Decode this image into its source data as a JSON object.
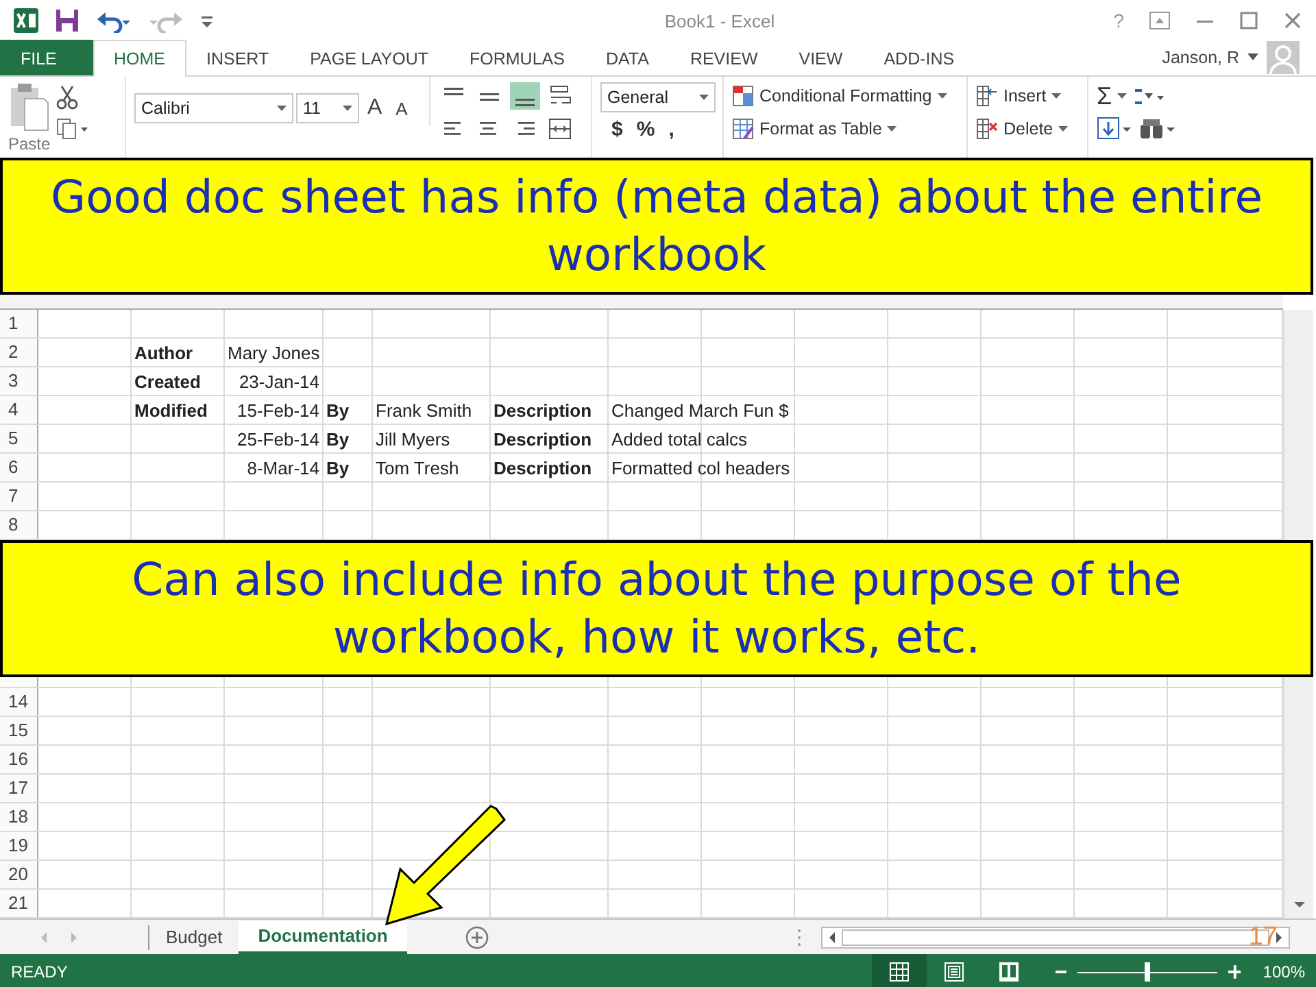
{
  "window": {
    "title": "Book1 - Excel",
    "help": "?"
  },
  "quick_access": {
    "redo": {
      "disabled": true
    }
  },
  "tabs": [
    {
      "label": "FILE",
      "kind": "file",
      "selected": false
    },
    {
      "label": "HOME",
      "kind": "tab",
      "selected": true
    },
    {
      "label": "INSERT",
      "kind": "tab",
      "selected": false
    },
    {
      "label": "PAGE LAYOUT",
      "kind": "tab",
      "selected": false
    },
    {
      "label": "FORMULAS",
      "kind": "tab",
      "selected": false
    },
    {
      "label": "DATA",
      "kind": "tab",
      "selected": false
    },
    {
      "label": "REVIEW",
      "kind": "tab",
      "selected": false
    },
    {
      "label": "VIEW",
      "kind": "tab",
      "selected": false
    },
    {
      "label": "ADD-INS",
      "kind": "tab",
      "selected": false
    }
  ],
  "account": {
    "name": "Janson, R"
  },
  "ribbon": {
    "paste_label": "Paste",
    "font_name": "Calibri",
    "font_size": "11",
    "font_buttons": [
      "A",
      "A"
    ],
    "alignment": [
      {
        "kind": "top",
        "selected": false
      },
      {
        "kind": "middle",
        "selected": false
      },
      {
        "kind": "bottom",
        "selected": true
      },
      {
        "kind": "wrap",
        "selected": false
      },
      {
        "kind": "left",
        "selected": false
      },
      {
        "kind": "center",
        "selected": false
      },
      {
        "kind": "right",
        "selected": false
      },
      {
        "kind": "merge",
        "selected": false
      }
    ],
    "number_format": "General",
    "number_buttons": [
      "$",
      "%",
      ","
    ],
    "styles": [
      {
        "kind": "conditional",
        "label": "Conditional Formatting"
      },
      {
        "kind": "table",
        "label": "Format as Table"
      }
    ],
    "cells": [
      {
        "kind": "insert",
        "label": "Insert"
      },
      {
        "kind": "delete",
        "label": "Delete"
      }
    ],
    "editing_symbol": "Σ"
  },
  "sheet": {
    "rows_top": [
      {
        "number": "1"
      },
      {
        "number": "2",
        "cells": [
          null,
          {
            "kind": "label",
            "text": "Author"
          },
          {
            "kind": "text",
            "text": "Mary Jones"
          }
        ]
      },
      {
        "number": "3",
        "cells": [
          null,
          {
            "kind": "label",
            "text": "Created"
          },
          {
            "kind": "date",
            "text": "23-Jan-14"
          }
        ]
      },
      {
        "number": "4",
        "cells": [
          null,
          {
            "kind": "label",
            "text": "Modified"
          },
          {
            "kind": "date",
            "text": "15-Feb-14"
          },
          {
            "kind": "label",
            "text": "By"
          },
          {
            "kind": "text",
            "text": "Frank Smith"
          },
          {
            "kind": "label",
            "text": "Description"
          },
          {
            "kind": "text",
            "text": "Changed March Fun $"
          }
        ]
      },
      {
        "number": "5",
        "cells": [
          null,
          null,
          {
            "kind": "date",
            "text": "25-Feb-14"
          },
          {
            "kind": "label",
            "text": "By"
          },
          {
            "kind": "text",
            "text": "Jill Myers"
          },
          {
            "kind": "label",
            "text": "Description"
          },
          {
            "kind": "text",
            "text": "Added total calcs"
          }
        ]
      },
      {
        "number": "6",
        "cells": [
          null,
          null,
          {
            "kind": "date",
            "text": "8-Mar-14"
          },
          {
            "kind": "label",
            "text": "By"
          },
          {
            "kind": "text",
            "text": "Tom Tresh"
          },
          {
            "kind": "label",
            "text": "Description"
          },
          {
            "kind": "text",
            "text": "Formatted col headers"
          }
        ]
      },
      {
        "number": "7"
      },
      {
        "number": "8"
      }
    ],
    "rows_bottom": [
      {
        "number": "14"
      },
      {
        "number": "15"
      },
      {
        "number": "16"
      },
      {
        "number": "17"
      },
      {
        "number": "18"
      },
      {
        "number": "19"
      },
      {
        "number": "20"
      },
      {
        "number": "21"
      }
    ]
  },
  "sheet_tabs": [
    {
      "label": "Budget",
      "selected": false
    },
    {
      "label": "Documentation",
      "selected": true
    }
  ],
  "status_bar": {
    "mode": "READY",
    "views": [
      {
        "kind": "normal",
        "selected": true
      },
      {
        "kind": "page_layout",
        "selected": false
      },
      {
        "kind": "page_break",
        "selected": false
      }
    ],
    "zoom": {
      "level": 0.5,
      "reading": "100%"
    }
  },
  "annotations": {
    "callouts": [
      "Good doc sheet has info (meta data) about the entire workbook",
      "Can also include info about the purpose of the workbook, how it works, etc."
    ],
    "slide_number": "17"
  }
}
